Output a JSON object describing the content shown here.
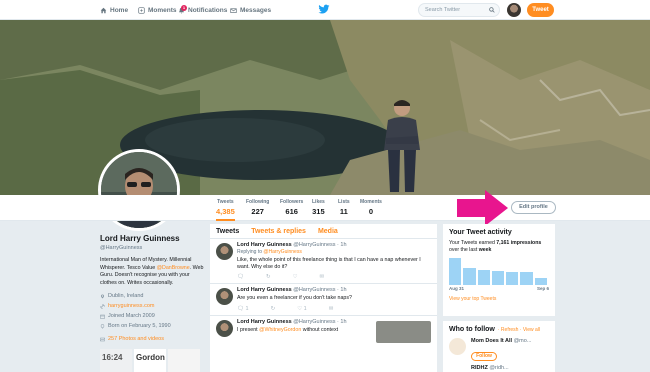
{
  "colors": {
    "accent": "#ff8d21",
    "arrow": "#e8158e",
    "link": "#ff8d21"
  },
  "topbar": {
    "home": "Home",
    "moments": "Moments",
    "notifications": "Notifications",
    "notifications_badge": "1",
    "messages": "Messages",
    "search_placeholder": "Search Twitter",
    "tweet_button": "Tweet"
  },
  "stats": [
    {
      "label": "Tweets",
      "value": "4,385"
    },
    {
      "label": "Following",
      "value": "227"
    },
    {
      "label": "Followers",
      "value": "616"
    },
    {
      "label": "Likes",
      "value": "315"
    },
    {
      "label": "Lists",
      "value": "11"
    },
    {
      "label": "Moments",
      "value": "0"
    }
  ],
  "edit_profile": "Edit profile",
  "profile": {
    "name": "Lord Harry Guinness",
    "handle": "@HarryGuinness",
    "bio_1": "International Man of Mystery. Millennial Whisperer. Tesco Value ",
    "bio_mention": "@DanBrowne",
    "bio_2": ". Web Guru. Doesn't recognise you with your clothes on. Writes occasionally.",
    "location": "Dublin, Ireland",
    "website": "harryguinness.com",
    "joined": "Joined March 2009",
    "born": "Born on February 5, 1990",
    "photos": "257 Photos and videos",
    "thumb_1": "16:24",
    "thumb_2": "Gordon"
  },
  "timeline": {
    "tabs": [
      "Tweets",
      "Tweets & replies",
      "Media"
    ],
    "tweets": [
      {
        "name": "Lord Harry Guinness",
        "meta": "@HarryGuinness · 1h",
        "reply_prefix": "Replying to ",
        "reply_to": "@HarryGuinness",
        "text": "Like, the whole point of this freelance thing is that I can have a nap whenever I want. Why else do it?",
        "replies": "",
        "retweets": "",
        "likes": ""
      },
      {
        "name": "Lord Harry Guinness",
        "meta": "@HarryGuinness · 1h",
        "text": "Are you even a freelancer if you don't take naps?",
        "replies": "1",
        "retweets": "",
        "likes": "1"
      },
      {
        "name": "Lord Harry Guinness",
        "meta": "@HarryGuinness · 1h",
        "text_prefix": "I present ",
        "text_mention": "@WhitneyGordon",
        "text_suffix": " without context"
      }
    ]
  },
  "activity": {
    "title": "Your Tweet activity",
    "text_1": "Your Tweets earned ",
    "impressions": "7,161 impressions",
    "text_2": " over the last ",
    "period": "week",
    "axis_start": "Aug 31",
    "axis_end": "Sep 6",
    "bars": [
      0.95,
      0.6,
      0.55,
      0.5,
      0.45,
      0.45,
      0.25
    ],
    "link": "View your top Tweets"
  },
  "who_to_follow": {
    "title": "Who to follow",
    "refresh": "· Refresh · View all",
    "suggestion_1": "Mom Does It All",
    "suggestion_1_handle": "@mo...",
    "follow_label": "Follow",
    "suggestion_2": "RIDHZ",
    "suggestion_2_handle": "@ridh..."
  }
}
